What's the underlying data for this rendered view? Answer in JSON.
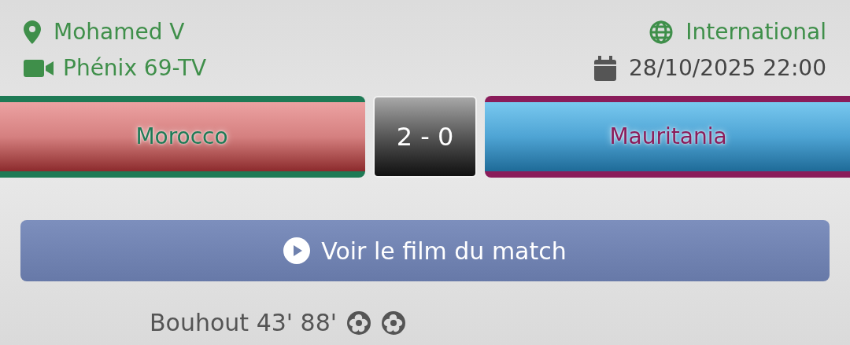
{
  "venue": {
    "stadium": "Mohamed V",
    "broadcaster": "Phénix 69-TV",
    "competition": "International",
    "datetime": "28/10/2025 22:00"
  },
  "teams": [
    {
      "name": "Morocco",
      "color": "#1e7a55"
    },
    {
      "name": "Mauritania",
      "color": "#8a1c5a"
    }
  ],
  "score": "2 - 0",
  "video_button": {
    "label": "Voir le film du match"
  },
  "scorers": [
    {
      "text": "Bouhout 43' 88'",
      "goals": [
        {
          "kind": "ball"
        },
        {
          "kind": "ball"
        }
      ]
    }
  ]
}
